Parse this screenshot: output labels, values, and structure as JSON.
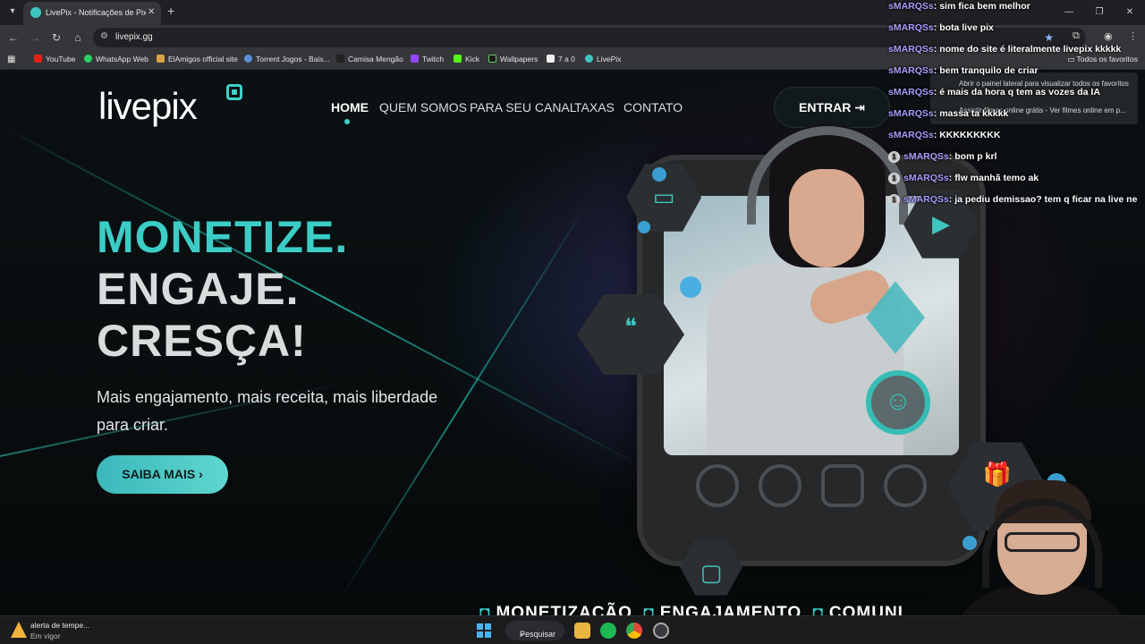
{
  "browser": {
    "tab_title": "LivePix - Notificações de Pix para lives",
    "url": "livepix.gg",
    "bookmarks": [
      "YouTube",
      "WhatsApp Web",
      "ElAmigos official site",
      "Torrent Jogos - Baix...",
      "Camisa Mengão",
      "Twitch",
      "Kick",
      "Wallpapers",
      "7 a 0",
      "LivePix"
    ],
    "all_bookmarks": "Todos os favoritos",
    "tooltip_1": "Abrir o painel lateral para visualizar todos os favoritos",
    "tooltip_2": "Assistir filmes online grátis - Ver filmes online em p..."
  },
  "site": {
    "logo": "livepix",
    "nav": [
      "HOME",
      "QUEM SOMOS",
      "PARA SEU CANAL",
      "TAXAS",
      "CONTATO"
    ],
    "enter_label": "ENTRAR",
    "headline": [
      "MONETIZE.",
      "ENGAJE.",
      "CRESÇA!"
    ],
    "subheadline": "Mais engajamento, mais receita, mais liberdade para criar.",
    "cta_label": "SAIBA MAIS",
    "marquee": [
      "MONETIZAÇÃO",
      "ENGAJAMENTO",
      "COMUNI"
    ]
  },
  "chat": [
    {
      "user": "sMARQSs",
      "text": "sim fica bem melhor"
    },
    {
      "user": "sMARQSs",
      "text": "bota live pix"
    },
    {
      "user": "sMARQSs",
      "text": "nome do site é literalmente livepix kkkkk"
    },
    {
      "user": "sMARQSs",
      "text": "bem tranquilo de criar"
    },
    {
      "user": "sMARQSs",
      "text": "é mais da hora q tem as vozes da IA"
    },
    {
      "user": "sMARQSs",
      "text": "massa ta kkkkk"
    },
    {
      "user": "sMARQSs",
      "text": "KKKKKKKKK"
    },
    {
      "user": "sMARQSs",
      "text": "bom p krl",
      "badge": "1"
    },
    {
      "user": "sMARQSs",
      "text": "flw manhã temo ak",
      "badge": "1"
    },
    {
      "user": "sMARQSs",
      "text": "ja pediu demissao? tem q ficar na live ne",
      "badge": "1"
    }
  ],
  "taskbar": {
    "weather_title": "alerta de tempe...",
    "weather_status": "Em vigor",
    "search_label": "Pesquisar"
  },
  "colors": {
    "accent": "#3fd0c8",
    "chat_user": "#a89cff"
  }
}
